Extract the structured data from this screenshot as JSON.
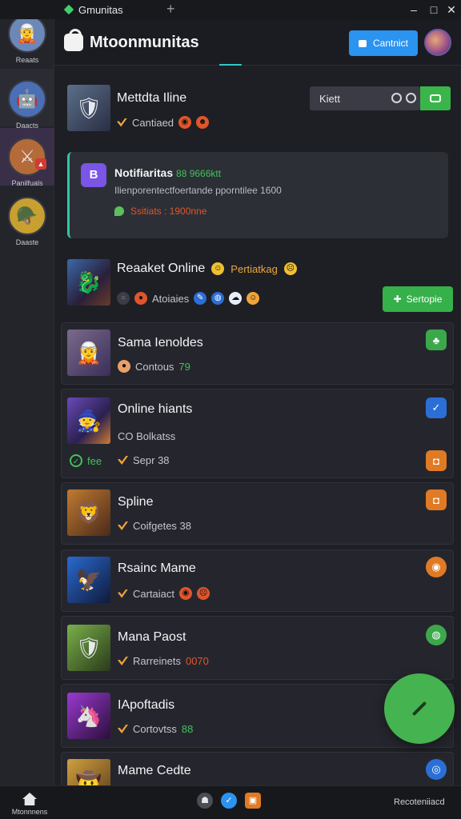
{
  "titlebar": {
    "tab_label": "Gmunitas",
    "close_glyph": "×",
    "add_glyph": "+",
    "minimize_glyph": "–",
    "maximize_glyph": "□",
    "close_window_glyph": "✕"
  },
  "sidebar": {
    "items": [
      {
        "label": "Reaats",
        "icon": "warrior-avatar",
        "color": "#6b88b8"
      },
      {
        "label": "Daacts",
        "icon": "robot-avatar",
        "color": "#4a6fb5"
      },
      {
        "label": "Panilfuals",
        "icon": "knight-avatar",
        "color": "#b56a3a",
        "badge": "▲"
      },
      {
        "label": "Daaste",
        "icon": "helmet-avatar",
        "color": "#c8a030"
      }
    ]
  },
  "header": {
    "title": "Mtoonmunitas",
    "connect_label": "Cantnict"
  },
  "search": {
    "placeholder": "Kiett"
  },
  "top_item": {
    "title": "Mettdta Iline",
    "meta": "Cantiaed"
  },
  "notification": {
    "title": "Notifiaritas",
    "count": "88 9666ktt",
    "body": "Ilienporentectfoertande pporntilee 1600",
    "status": "Ssitiats : 1900nne"
  },
  "featured": {
    "title": "Reaaket Online",
    "tag": "Pertiatkag",
    "meta": "Atoiaies",
    "button_label": "Sertopie"
  },
  "list": [
    {
      "title": "Sama Ienoldes",
      "meta": "Contous",
      "meta_value": "79",
      "thumb_color": "#5a4f8a",
      "action_color": "#3ba84a",
      "action_icon": "♣"
    },
    {
      "title": "Online hiants",
      "meta": "CO Bolkatss",
      "extra_a": "fee",
      "extra_b": "Sepr 38",
      "thumb_color": "#3c3a7a",
      "action_color": "#2b6fd6",
      "action_icon": "✓"
    },
    {
      "title": "Spline",
      "meta": "Coifgetes 38",
      "thumb_color": "#7a4a2a",
      "action_color": "#e07a25",
      "action_icon": "◘"
    },
    {
      "title": "Rsainc Mame",
      "meta": "Cartaiact",
      "thumb_color": "#1e3a6a",
      "action_color": "#e07a25",
      "action_icon": "◉"
    },
    {
      "title": "Mana Paost",
      "meta": "Rarreinets",
      "meta_value": "0070",
      "thumb_color": "#4a6a3a",
      "action_color": "#3ba84a",
      "action_icon": "◍"
    },
    {
      "title": "IApoftadis",
      "meta": "Cortovtss",
      "meta_value": "88",
      "thumb_color": "#4a2a7a"
    },
    {
      "title": "Mame Cedte",
      "thumb_color": "#7a5a3a",
      "action_color": "#2b6fd6",
      "action_icon": "◎"
    }
  ],
  "bottombar": {
    "home_label": "Mtonnnens",
    "right_label": "Recoteniiacd"
  }
}
